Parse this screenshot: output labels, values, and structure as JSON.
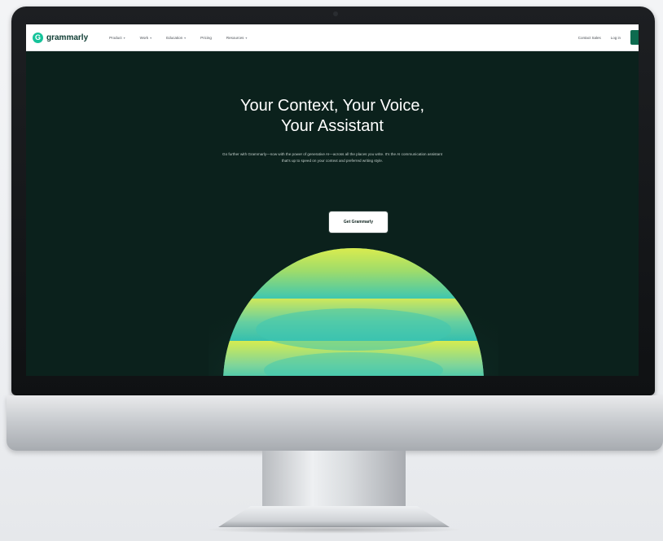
{
  "site": {
    "logo_text": "grammarly",
    "logo_glyph": "G",
    "nav": [
      {
        "label": "Product",
        "has_menu": true
      },
      {
        "label": "Work",
        "has_menu": true
      },
      {
        "label": "Education",
        "has_menu": true
      },
      {
        "label": "Pricing",
        "has_menu": false
      },
      {
        "label": "Resources",
        "has_menu": true
      }
    ],
    "nav_right": [
      {
        "label": "Contact Sales"
      },
      {
        "label": "Log in"
      }
    ],
    "hero": {
      "title_line1": "Your Context, Your Voice,",
      "title_line2": "Your Assistant",
      "subtitle": "Go further with Grammarly—now with the power of generative AI—across all the places you write. It's the AI communication assistant that's up to speed on your context and preferred writing style.",
      "cta_label": "Get Grammarly"
    }
  },
  "colors": {
    "screen_bg": "#0b211c",
    "brand_green": "#15c39a",
    "orb_yellow": "#d9ec4e",
    "orb_teal": "#3fc7b0"
  }
}
